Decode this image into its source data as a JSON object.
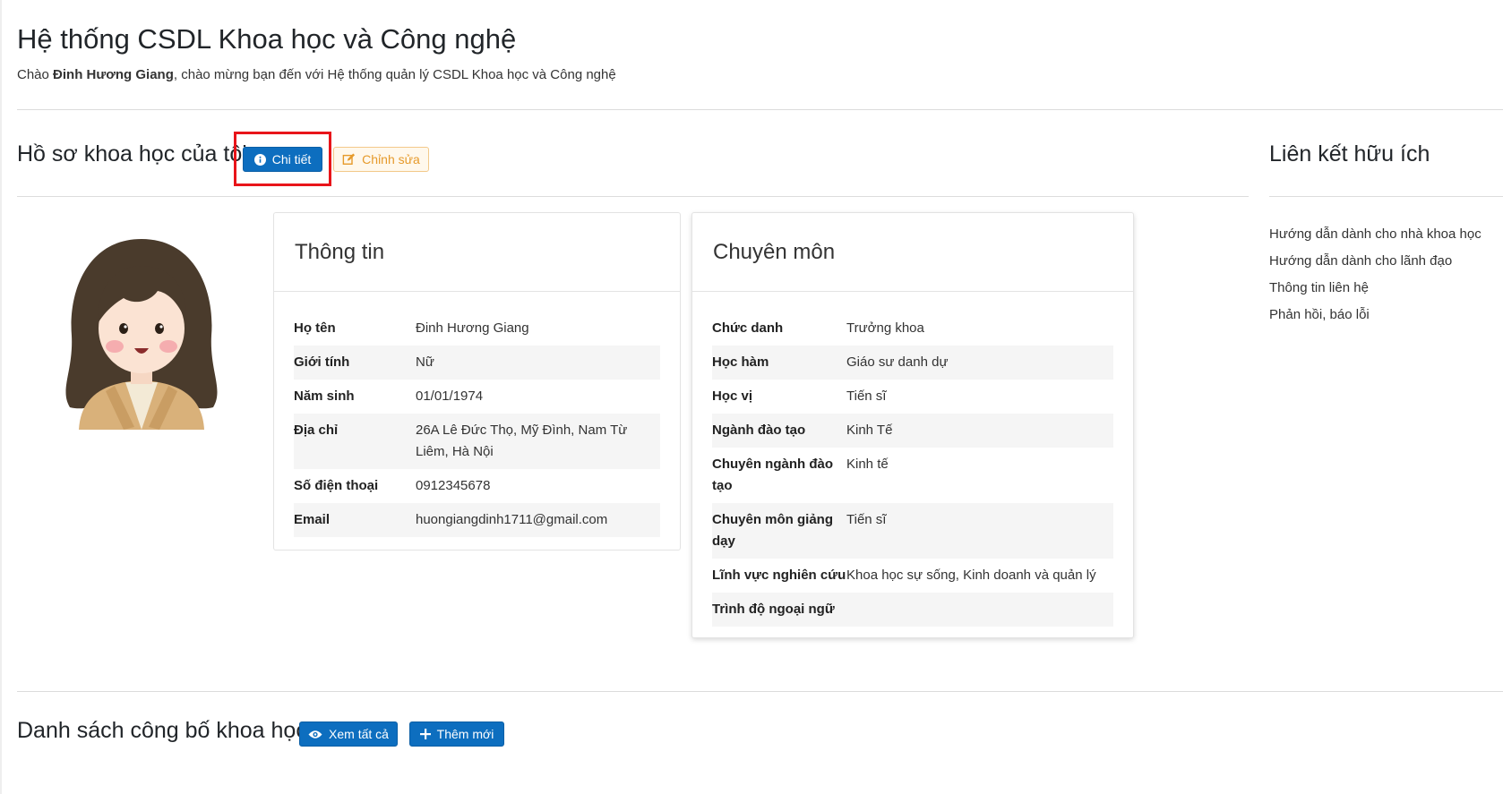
{
  "header": {
    "title": "Hệ thống CSDL Khoa học và Công nghệ",
    "welcome_prefix": "Chào ",
    "user_name": "Đinh Hương Giang",
    "welcome_suffix": ", chào mừng bạn đến với Hệ thống quản lý CSDL Khoa học và Công nghệ"
  },
  "profile_section": {
    "title": "Hồ sơ khoa học của tôi",
    "detail_button": "Chi tiết",
    "detail_icon": "info-circle-icon",
    "edit_button": "Chỉnh sửa",
    "edit_icon": "edit-icon"
  },
  "info_card": {
    "title": "Thông tin",
    "rows": [
      {
        "label": "Họ tên",
        "value": "Đinh Hương Giang"
      },
      {
        "label": "Giới tính",
        "value": "Nữ"
      },
      {
        "label": "Năm sinh",
        "value": "01/01/1974"
      },
      {
        "label": "Địa chỉ",
        "value": "26A Lê Đức Thọ, Mỹ Đình, Nam Từ Liêm, Hà Nội"
      },
      {
        "label": "Số điện thoại",
        "value": "0912345678"
      },
      {
        "label": "Email",
        "value": "huongiangdinh1711@gmail.com"
      }
    ]
  },
  "expertise_card": {
    "title": "Chuyên môn",
    "rows": [
      {
        "label": "Chức danh",
        "value": "Trưởng khoa"
      },
      {
        "label": "Học hàm",
        "value": "Giáo sư danh dự"
      },
      {
        "label": "Học vị",
        "value": "Tiến sĩ"
      },
      {
        "label": "Ngành đào tạo",
        "value": "Kinh Tế"
      },
      {
        "label": "Chuyên ngành đào tạo",
        "value": "Kinh tế"
      },
      {
        "label": "Chuyên môn giảng dạy",
        "value": "Tiến sĩ"
      },
      {
        "label": "Lĩnh vực nghiên cứu",
        "value": "Khoa học sự sống, Kinh doanh và quản lý"
      },
      {
        "label": "Trình độ ngoại ngữ",
        "value": ""
      }
    ]
  },
  "useful_links": {
    "title": "Liên kết hữu ích",
    "items": [
      {
        "label": "Hướng dẫn dành cho nhà khoa học"
      },
      {
        "label": "Hướng dẫn dành cho lãnh đạo"
      },
      {
        "label": "Thông tin liên hệ"
      },
      {
        "label": "Phản hồi, báo lỗi"
      }
    ]
  },
  "publications_section": {
    "title": "Danh sách công bố khoa học",
    "view_all_button": "Xem tất cả",
    "view_all_icon": "eye-icon",
    "add_button": "Thêm mới",
    "add_icon": "plus-icon"
  },
  "colors": {
    "primary": "#0d6ebf",
    "warning": "#e69a2b",
    "highlight": "#e8141a"
  }
}
